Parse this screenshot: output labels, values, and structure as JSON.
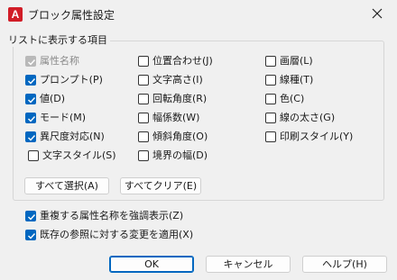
{
  "window": {
    "title": "ブロック属性設定",
    "app_icon_letter": "A"
  },
  "group": {
    "label": "リストに表示する項目"
  },
  "columns": [
    [
      {
        "label": "属性名称",
        "checked": true,
        "disabled": true
      },
      {
        "label": "プロンプト(P)",
        "checked": true
      },
      {
        "label": "値(D)",
        "checked": true
      },
      {
        "label": "モード(M)",
        "checked": true
      },
      {
        "label": "異尺度対応(N)",
        "checked": true
      },
      {
        "label": "文字スタイル(S)",
        "checked": false
      }
    ],
    [
      {
        "label": "位置合わせ(J)",
        "checked": false
      },
      {
        "label": "文字高さ(I)",
        "checked": false
      },
      {
        "label": "回転角度(R)",
        "checked": false
      },
      {
        "label": "幅係数(W)",
        "checked": false
      },
      {
        "label": "傾斜角度(O)",
        "checked": false
      },
      {
        "label": "境界の幅(D)",
        "checked": false
      }
    ],
    [
      {
        "label": "画層(L)",
        "checked": false
      },
      {
        "label": "線種(T)",
        "checked": false
      },
      {
        "label": "色(C)",
        "checked": false
      },
      {
        "label": "線の太さ(G)",
        "checked": false
      },
      {
        "label": "印刷スタイル(Y)",
        "checked": false
      }
    ]
  ],
  "select_all_label": "すべて選択(A)",
  "clear_all_label": "すべてクリア(E)",
  "options": [
    {
      "label": "重複する属性名称を強調表示(Z)",
      "checked": true
    },
    {
      "label": "既存の参照に対する変更を適用(X)",
      "checked": true
    }
  ],
  "buttons": {
    "ok": "OK",
    "cancel": "キャンセル",
    "help": "ヘルプ(H)"
  },
  "colors": {
    "accent": "#0067c0",
    "autocad_red": "#d11d27",
    "disabled_check": "#b9b9b9"
  }
}
